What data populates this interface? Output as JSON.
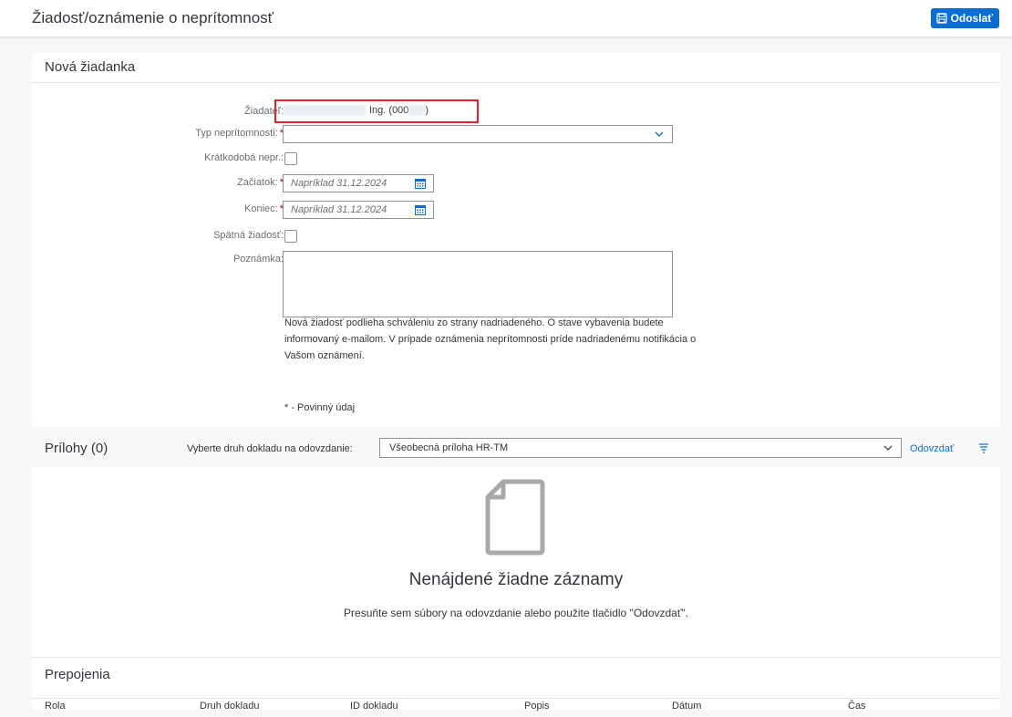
{
  "header": {
    "title": "Žiadosť/oznámenie o neprítomnosť",
    "send_label": "Odoslať"
  },
  "form": {
    "section_title": "Nová žiadanka",
    "applicant_label": "Žiadateľ:",
    "applicant_value_visible": "Ing. (000",
    "applicant_value_end": ")",
    "absence_type_label": "Typ neprítomnosti:",
    "absence_type_value": "",
    "short_absence_label": "Krátkodobá nepr.:",
    "start_label": "Začiatok:",
    "start_placeholder": "Napríklad 31.12.2024",
    "end_label": "Koniec:",
    "end_placeholder": "Napríklad 31.12.2024",
    "retro_label": "Spätná žiadosť:",
    "note_label": "Poznámka:",
    "info_text": "Nová žiadosť podlieha schváleniu zo strany nadriadeného. O stave vybavenia budete informovaný e-mailom. V prípade oznámenia neprítomnosti príde nadriadenému notifikácia o Vašom oznámení.",
    "required_note": "* - Povinný údaj"
  },
  "attachments": {
    "title": "Prílohy (0)",
    "doc_type_label": "Vyberte druh dokladu na odovzdanie:",
    "doc_type_value": "Všeobecná príloha HR-TM",
    "upload_label": "Odovzdať",
    "empty_title": "Nenájdené žiadne záznamy",
    "empty_subtitle": "Presuňte sem súbory na odovzdanie alebo použite tlačidlo \"Odovzdať\"."
  },
  "links": {
    "title": "Prepojenia",
    "columns": [
      "Rola",
      "Druh dokladu",
      "ID dokladu",
      "Popis",
      "Dátum",
      "Čas"
    ]
  },
  "colors": {
    "accent": "#0a6ed1",
    "required": "#bb0000",
    "highlight": "#e0262b"
  }
}
